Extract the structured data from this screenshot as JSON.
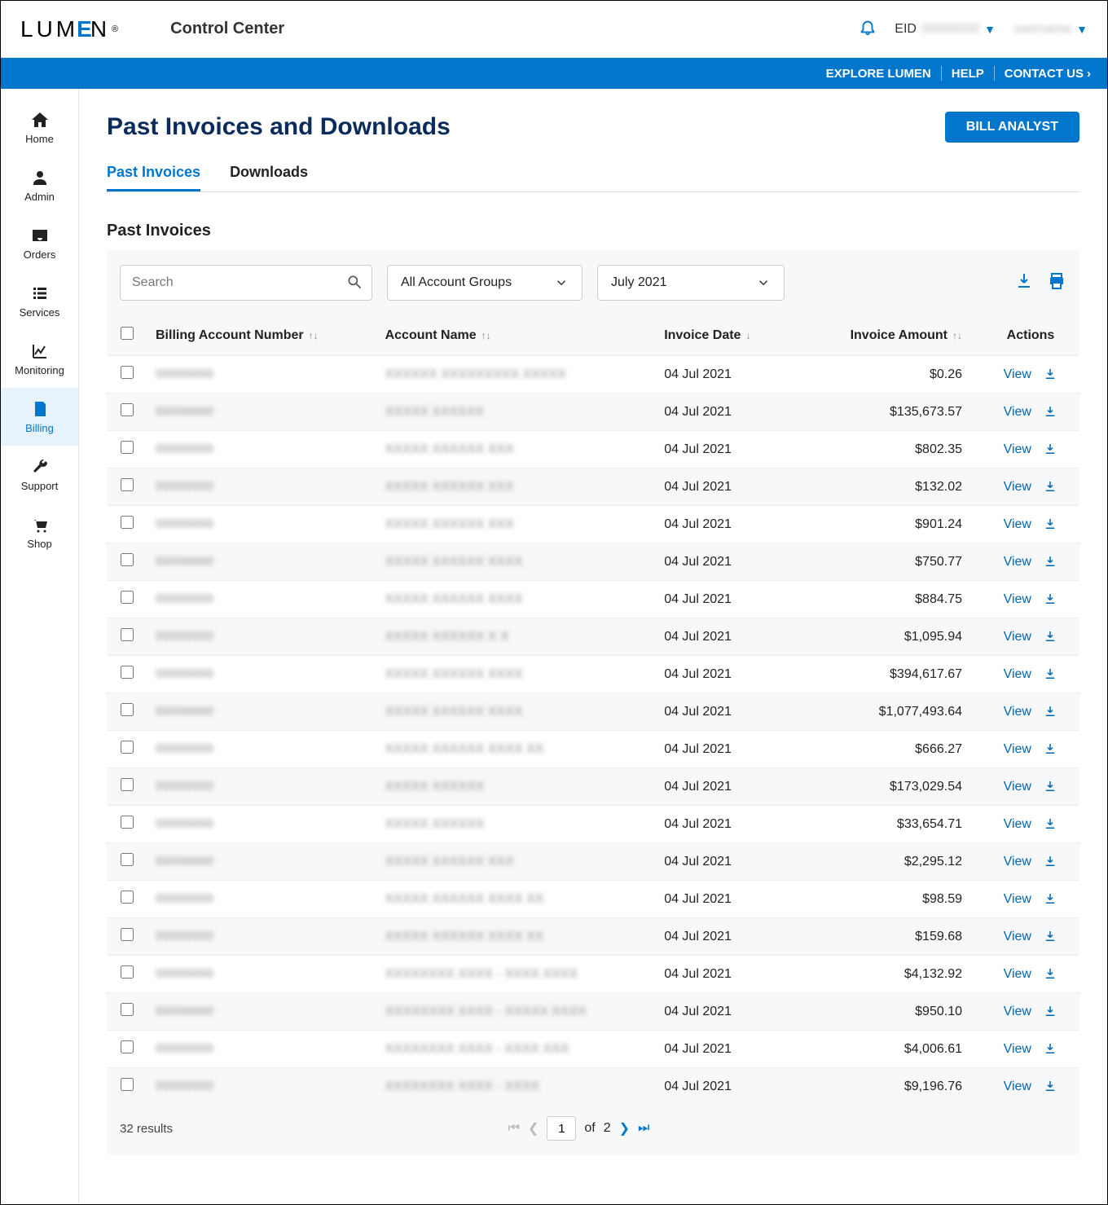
{
  "header": {
    "logo_text": "LUMEN",
    "app_title": "Control Center",
    "eid_label": "EID",
    "eid_value": "00000000",
    "username": "username"
  },
  "bluebar": {
    "explore": "EXPLORE LUMEN",
    "help": "HELP",
    "contact": "CONTACT US"
  },
  "sidebar": [
    {
      "id": "home",
      "label": "Home"
    },
    {
      "id": "admin",
      "label": "Admin"
    },
    {
      "id": "orders",
      "label": "Orders"
    },
    {
      "id": "services",
      "label": "Services"
    },
    {
      "id": "monitoring",
      "label": "Monitoring"
    },
    {
      "id": "billing",
      "label": "Billing",
      "active": true
    },
    {
      "id": "support",
      "label": "Support"
    },
    {
      "id": "shop",
      "label": "Shop"
    }
  ],
  "page": {
    "title": "Past Invoices and Downloads",
    "analyst_btn": "BILL ANALYST",
    "tabs": [
      "Past Invoices",
      "Downloads"
    ],
    "active_tab": 0,
    "section_title": "Past Invoices"
  },
  "filters": {
    "search_placeholder": "Search",
    "account_groups": "All Account Groups",
    "period": "July 2021"
  },
  "columns": {
    "ban": "Billing Account Number",
    "acct": "Account Name",
    "date": "Invoice Date",
    "amt": "Invoice Amount",
    "actions": "Actions",
    "view": "View"
  },
  "rows": [
    {
      "ban": "00000000",
      "acct": "XXXXXX XXXXXXXXX XXXXX",
      "date": "04 Jul 2021",
      "amt": "$0.26"
    },
    {
      "ban": "00000000",
      "acct": "XXXXX XXXXXX",
      "date": "04 Jul 2021",
      "amt": "$135,673.57"
    },
    {
      "ban": "00000000",
      "acct": "XXXXX XXXXXX XXX",
      "date": "04 Jul 2021",
      "amt": "$802.35"
    },
    {
      "ban": "00000000",
      "acct": "XXXXX XXXXXX XXX",
      "date": "04 Jul 2021",
      "amt": "$132.02"
    },
    {
      "ban": "00000000",
      "acct": "XXXXX XXXXXX XXX",
      "date": "04 Jul 2021",
      "amt": "$901.24"
    },
    {
      "ban": "00000000",
      "acct": "XXXXX XXXXXX XXXX",
      "date": "04 Jul 2021",
      "amt": "$750.77"
    },
    {
      "ban": "00000000",
      "acct": "XXXXX XXXXXX XXXX",
      "date": "04 Jul 2021",
      "amt": "$884.75"
    },
    {
      "ban": "00000000",
      "acct": "XXXXX XXXXXX X X",
      "date": "04 Jul 2021",
      "amt": "$1,095.94"
    },
    {
      "ban": "00000000",
      "acct": "XXXXX XXXXXX XXXX",
      "date": "04 Jul 2021",
      "amt": "$394,617.67"
    },
    {
      "ban": "00000000",
      "acct": "XXXXX XXXXXX XXXX",
      "date": "04 Jul 2021",
      "amt": "$1,077,493.64"
    },
    {
      "ban": "00000000",
      "acct": "XXXXX XXXXXX XXXX XX",
      "date": "04 Jul 2021",
      "amt": "$666.27"
    },
    {
      "ban": "00000000",
      "acct": "XXXXX XXXXXX",
      "date": "04 Jul 2021",
      "amt": "$173,029.54"
    },
    {
      "ban": "00000000",
      "acct": "XXXXX XXXXXX",
      "date": "04 Jul 2021",
      "amt": "$33,654.71"
    },
    {
      "ban": "00000000",
      "acct": "XXXXX XXXXXX XXX",
      "date": "04 Jul 2021",
      "amt": "$2,295.12"
    },
    {
      "ban": "00000000",
      "acct": "XXXXX XXXXXX XXXX XX",
      "date": "04 Jul 2021",
      "amt": "$98.59"
    },
    {
      "ban": "00000000",
      "acct": "XXXXX XXXXXX XXXX XX",
      "date": "04 Jul 2021",
      "amt": "$159.68"
    },
    {
      "ban": "00000000",
      "acct": "XXXXXXXX XXXX - XXXX XXXX",
      "date": "04 Jul 2021",
      "amt": "$4,132.92"
    },
    {
      "ban": "00000000",
      "acct": "XXXXXXXX XXXX - XXXXX XXXX",
      "date": "04 Jul 2021",
      "amt": "$950.10"
    },
    {
      "ban": "00000000",
      "acct": "XXXXXXXX XXXX - XXXX XXX",
      "date": "04 Jul 2021",
      "amt": "$4,006.61"
    },
    {
      "ban": "00000000",
      "acct": "XXXXXXXX XXXX - XXXX",
      "date": "04 Jul 2021",
      "amt": "$9,196.76"
    }
  ],
  "pagination": {
    "results_text": "32 results",
    "current_page": "1",
    "of_label": "of",
    "total_pages": "2"
  }
}
